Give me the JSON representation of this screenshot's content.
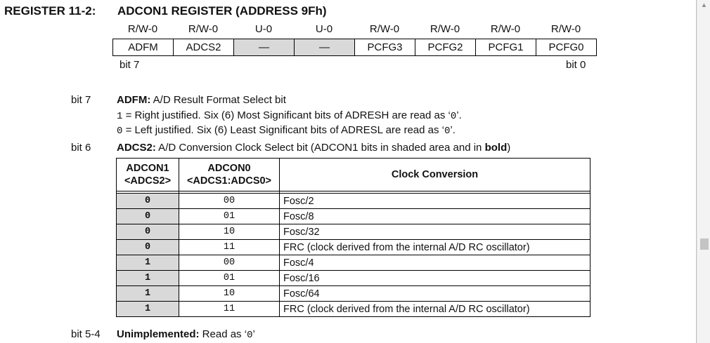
{
  "register": {
    "label": "REGISTER 11-2:",
    "title": "ADCON1 REGISTER (ADDRESS 9Fh)",
    "access": [
      "R/W-0",
      "R/W-0",
      "U-0",
      "U-0",
      "R/W-0",
      "R/W-0",
      "R/W-0",
      "R/W-0"
    ],
    "bits": [
      {
        "name": "ADFM",
        "shaded": false
      },
      {
        "name": "ADCS2",
        "shaded": false
      },
      {
        "name": "—",
        "shaded": true
      },
      {
        "name": "—",
        "shaded": true
      },
      {
        "name": "PCFG3",
        "shaded": false
      },
      {
        "name": "PCFG2",
        "shaded": false
      },
      {
        "name": "PCFG1",
        "shaded": false
      },
      {
        "name": "PCFG0",
        "shaded": false
      }
    ],
    "msb_label": "bit 7",
    "lsb_label": "bit 0"
  },
  "bit7": {
    "label": "bit 7",
    "name": "ADFM:",
    "desc": " A/D Result Format Select bit",
    "opt1_val": "1",
    "opt1_text": " = Right justified. Six (6) Most Significant bits of ADRESH are read as ‘",
    "opt1_code": "0",
    "opt1_end": "’.",
    "opt0_val": "0",
    "opt0_text": " = Left justified. Six (6) Least Significant bits of ADRESL are read as ‘",
    "opt0_code": "0",
    "opt0_end": "’."
  },
  "bit6": {
    "label": "bit 6",
    "name": "ADCS2:",
    "desc": " A/D Conversion Clock Select bit (ADCON1 bits in shaded area and in ",
    "desc_bold": "bold",
    "desc_end": ")"
  },
  "clock_table": {
    "h1_line1": "ADCON1",
    "h1_line2": "<ADCS2>",
    "h2_line1": "ADCON0",
    "h2_line2": "<ADCS1:ADCS0>",
    "h3": "Clock Conversion",
    "rows": [
      {
        "adcs2": "0",
        "adcs10": "00",
        "conv": "Fosc/2"
      },
      {
        "adcs2": "0",
        "adcs10": "01",
        "conv": "Fosc/8"
      },
      {
        "adcs2": "0",
        "adcs10": "10",
        "conv": "Fosc/32"
      },
      {
        "adcs2": "0",
        "adcs10": "11",
        "conv": "FRC (clock derived from the internal A/D RC oscillator)"
      },
      {
        "adcs2": "1",
        "adcs10": "00",
        "conv": "Fosc/4"
      },
      {
        "adcs2": "1",
        "adcs10": "01",
        "conv": "Fosc/16"
      },
      {
        "adcs2": "1",
        "adcs10": "10",
        "conv": "Fosc/64"
      },
      {
        "adcs2": "1",
        "adcs10": "11",
        "conv": "FRC (clock derived from the internal A/D RC oscillator)"
      }
    ]
  },
  "bit54": {
    "label": "bit 5-4",
    "name": "Unimplemented:",
    "desc": " Read as ‘",
    "code": "0",
    "end": "’"
  }
}
